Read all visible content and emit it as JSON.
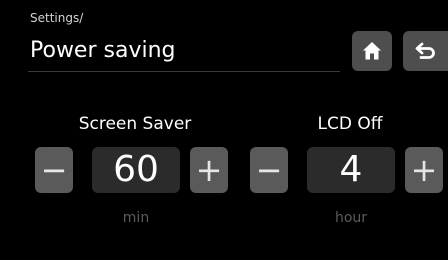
{
  "header": {
    "breadcrumb": "Settings/",
    "title": "Power saving"
  },
  "buttons": {
    "home_icon": "home-icon",
    "back_icon": "back-arrow-icon"
  },
  "screen_saver": {
    "label": "Screen Saver",
    "value": "60",
    "unit": "min",
    "minus_label": "−",
    "plus_label": "+"
  },
  "lcd_off": {
    "label": "LCD Off",
    "value": "4",
    "unit": "hour",
    "minus_label": "−",
    "plus_label": "+"
  },
  "colors": {
    "background": "#000000",
    "button_bg": "#5a5a5a",
    "value_bg": "#2b2b2b",
    "unit_text": "#5c5c5c"
  }
}
